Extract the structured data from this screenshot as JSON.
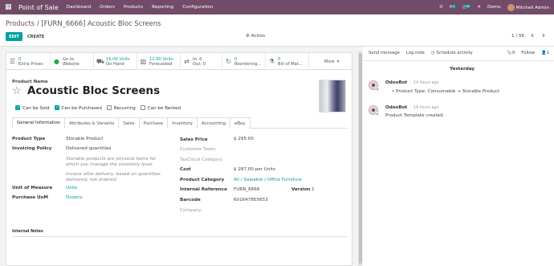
{
  "navbar": {
    "apps_icon": "grid-icon",
    "brand": "Point of Sale",
    "menus": [
      "Dashboard",
      "Orders",
      "Products",
      "Reporting",
      "Configuration"
    ],
    "messages_count": "4",
    "activities_count": "36",
    "company": "Demo",
    "user": "Mitchell Admin",
    "brand_color": "#714b67"
  },
  "control_panel": {
    "breadcrumb_parent": "Products",
    "breadcrumb_sep": " / ",
    "breadcrumb_current": "[FURN_6666] Acoustic Bloc Screens",
    "edit_label": "EDIT",
    "create_label": "CREATE",
    "action_label": "Action",
    "pager": "1 / 56",
    "accent_color": "#00a09d"
  },
  "stat_buttons": [
    {
      "icon": "list-icon",
      "value": "0",
      "label": "Extra Prices"
    },
    {
      "icon": "globe-icon",
      "value": "Go to",
      "label": "Website"
    },
    {
      "icon": "truck-icon",
      "value": "16.00 Units",
      "label": "On Hand"
    },
    {
      "icon": "chart-icon",
      "value": "12.00 Units",
      "label": "Forecasted"
    },
    {
      "icon": "transfer-icon",
      "value": "In: 0",
      "label": "Out: 0"
    },
    {
      "icon": "refresh-icon",
      "value": "0",
      "label": "Reordering..."
    },
    {
      "icon": "flask-icon",
      "value": "0",
      "label": "Bill of Mat..."
    },
    {
      "icon": "more-icon",
      "value": "More",
      "label": ""
    }
  ],
  "product": {
    "name_label": "Product Name",
    "name": "Acoustic Bloc Screens",
    "can_be_sold": "Can be Sold",
    "can_be_purchased": "Can be Purchased",
    "recurring": "Recurring",
    "can_be_rented": "Can be Rented"
  },
  "tabs": [
    "General Information",
    "Attributes & Variants",
    "Sales",
    "Purchase",
    "Inventory",
    "Accounting",
    "eBay"
  ],
  "general": {
    "product_type_label": "Product Type",
    "product_type": "Storable Product",
    "invoicing_policy_label": "Invoicing Policy",
    "invoicing_policy": "Delivered quantities",
    "note1": "Storable products are physical items for which you manage the inventory level.",
    "note2": "Invoice after delivery, based on quantities delivered, not ordered.",
    "uom_label": "Unit of Measure",
    "uom": "Units",
    "purchase_uom_label": "Purchase UoM",
    "purchase_uom": "Dozens",
    "sales_price_label": "Sales Price",
    "sales_price": "$ 295.00",
    "customer_taxes_label": "Customer Taxes",
    "taxcloud_label": "TaxCloud Category",
    "cost_label": "Cost",
    "cost": "$ 287.00 per Units",
    "category_label": "Product Category",
    "category": "All / Saleable / Office Furniture",
    "internal_ref_label": "Internal Reference",
    "internal_ref": "FURN_6666",
    "version_label": "Version",
    "version": "1",
    "barcode_label": "Barcode",
    "barcode": "601647855653",
    "company_label": "Company",
    "internal_notes_label": "Internal Notes"
  },
  "chatter": {
    "send_message": "Send message",
    "log_note": "Log note",
    "schedule_activity": "Schedule activity",
    "attachments": "0",
    "follow": "Follow",
    "followers": "1",
    "day_separator": "Yesterday",
    "messages": [
      {
        "author": "OdooBot",
        "time": "14 hours ago",
        "body": "Product Type: Consumable → Storable Product"
      },
      {
        "author": "OdooBot",
        "time": "14 hours ago",
        "body": "Product Template created"
      }
    ]
  }
}
